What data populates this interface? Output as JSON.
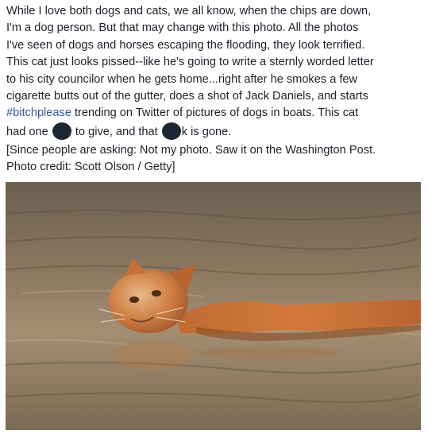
{
  "post": {
    "lines": [
      "While I love both dogs and cats, we all know, when the chips are down,",
      "I'm a dog person. But that may change with this photo. All the photos",
      "I've seen of dogs and horses escaping the flooding, they look terrified.",
      "This cat just looks pissed--like he's going to write a sternly worded letter",
      "to his city councilor when he gets home...right after he smokes a few",
      "cigarette butts out of the gutter, does a shot of Jack Daniels, and starts"
    ],
    "line7_hashtag": "#bitchplease",
    "line7_rest": " trending on Twitter of pictures of dogs in boats. This cat",
    "line8_a": "had one ",
    "line8_b": " to give, and that ",
    "line8_c": "k is gone.",
    "note_line1": "[Since people are asking: Not my photo. Saw it on the Washington Post.",
    "note_line2": "Photo credit: Scott Olson / Getty]"
  },
  "photo": {
    "description_icon": "swimming-cat-photo",
    "colors": {
      "water_dark": "#5e5444",
      "water_light": "#a08c70",
      "cat_fur": "#c8733a"
    }
  }
}
